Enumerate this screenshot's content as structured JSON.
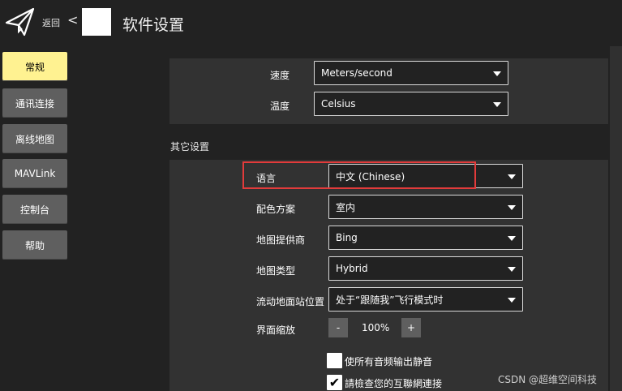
{
  "header": {
    "back_label": "返回",
    "back_chevron": "<",
    "title": "软件设置",
    "logo_icon": "paper-plane-icon"
  },
  "sidebar": {
    "items": [
      {
        "label": "常规",
        "active": true
      },
      {
        "label": "通讯连接",
        "active": false
      },
      {
        "label": "离线地图",
        "active": false
      },
      {
        "label": "MAVLink",
        "active": false
      },
      {
        "label": "控制台",
        "active": false
      },
      {
        "label": "帮助",
        "active": false
      }
    ]
  },
  "units": {
    "speed_label": "速度",
    "speed_value": "Meters/second",
    "temperature_label": "温度",
    "temperature_value": "Celsius"
  },
  "other": {
    "section_title": "其它设置",
    "language_label": "语言",
    "language_value": "中文 (Chinese)",
    "color_scheme_label": "配色方案",
    "color_scheme_value": "室内",
    "map_provider_label": "地图提供商",
    "map_provider_value": "Bing",
    "map_type_label": "地图类型",
    "map_type_value": "Hybrid",
    "gcs_position_label": "流动地面站位置",
    "gcs_position_value": "处于“跟随我”飞行模式时",
    "ui_scale_label": "界面缩放",
    "ui_scale_minus": "-",
    "ui_scale_value": "100%",
    "ui_scale_plus": "+",
    "mute_audio_label": "使所有音频输出静音",
    "mute_audio_checked": false,
    "check_internet_label": "請檢查您的互聯網連接",
    "check_internet_checked": true,
    "check_mark": "✔"
  },
  "watermark": "CSDN @超维空间科技",
  "colors": {
    "background": "#222222",
    "panel": "#323232",
    "active_tab": "#fff291",
    "button": "#5f5f5f",
    "highlight": "#e23b3b"
  }
}
